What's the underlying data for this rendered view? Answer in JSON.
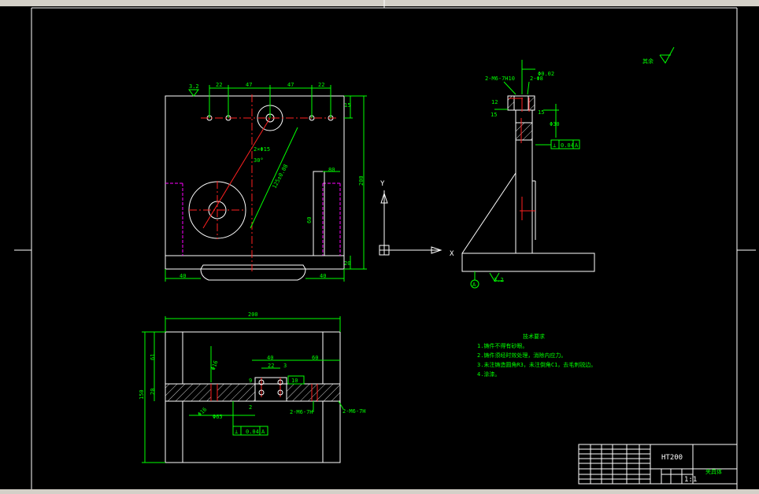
{
  "colors": {
    "background": "#000000",
    "outline": "#ffffff",
    "dimension": "#00ff00",
    "centerline": "#ff2020",
    "hidden": "#ff00ff"
  },
  "front_view": {
    "dims_top": [
      "22",
      "47",
      "47",
      "22"
    ],
    "dim_right_top": "15",
    "dim_right_height": "200",
    "dim_mid_right": "80",
    "dim_mid_vertical": "60",
    "dim_bottom_left": "40",
    "dim_bottom_right": "40",
    "dim_bottom_height": "20",
    "dim_angle": "30°",
    "dim_hole": "2×Φ15",
    "dim_diag": "125±0.08",
    "roughness": "3.2"
  },
  "side_view": {
    "label_thread": "2-M6-7H10",
    "label_hole": "2-Φ8",
    "label_tol": "Φ0.02",
    "dim_12": "12",
    "dim_15": "15",
    "dim_30": "Φ30",
    "tolerance_box": [
      "⊥",
      "0.04",
      "A"
    ],
    "datum": "A",
    "roughness": "3.2",
    "labels": [
      "Y",
      "X"
    ]
  },
  "top_view": {
    "dim_width": "200",
    "dim_height": "150",
    "dim_61": "61",
    "dim_20": "20",
    "dim_40": "40",
    "dim_22": "22",
    "dim_3": "3",
    "dim_60": "60",
    "dim_9": "9",
    "dim_10": "10",
    "dim_2": "2",
    "dim_65": "Φ65",
    "dim_16": "Φ16",
    "thread_a": "2-M6-7H",
    "thread_b": "2-M6-7H",
    "tolerance_box": [
      "⊥",
      "0.04",
      "A"
    ]
  },
  "notes": {
    "title": "技术要求",
    "lines": [
      "1.铸件不得有砂眼。",
      "2.铸件须经时效处理，消除内应力。",
      "3.未注铸造圆角R3，未注倒角C1，去毛刺锐边。",
      "4.涂漆。"
    ]
  },
  "surface_mark": {
    "label": "其余"
  },
  "title_block": {
    "material": "HT200",
    "part_name": "夹具体",
    "scale": "1:1"
  }
}
